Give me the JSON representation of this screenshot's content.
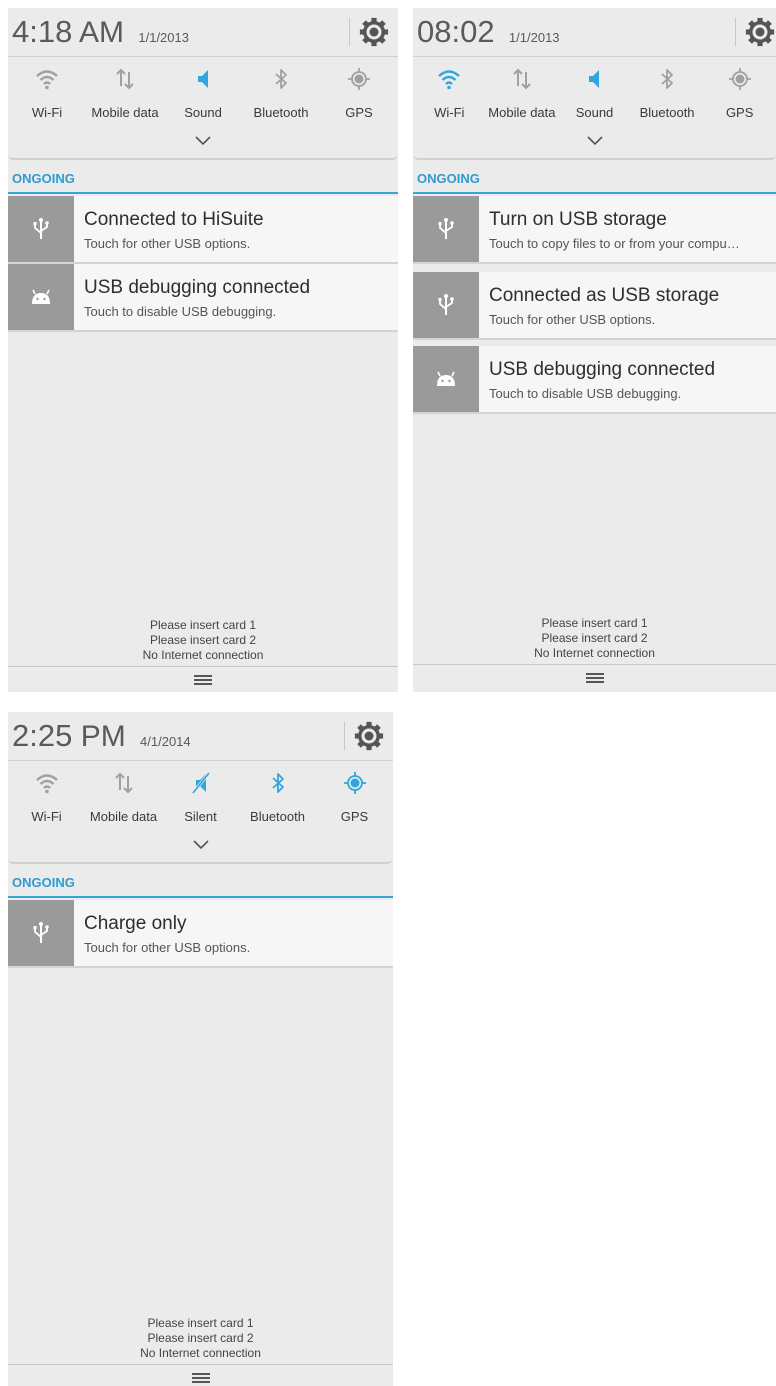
{
  "panels": [
    {
      "time": "4:18",
      "ampm": "AM",
      "date": "1/1/2013",
      "toggles": [
        {
          "label": "Wi-Fi",
          "icon": "wifi-icon",
          "active": false
        },
        {
          "label": "Mobile data",
          "icon": "mobile-data-icon",
          "active": false
        },
        {
          "label": "Sound",
          "icon": "sound-icon",
          "active": true
        },
        {
          "label": "Bluetooth",
          "icon": "bluetooth-icon",
          "active": false
        },
        {
          "label": "GPS",
          "icon": "gps-icon",
          "active": false
        }
      ],
      "section": "ONGOING",
      "notifications": [
        {
          "title": "Connected to HiSuite",
          "subtitle": "Touch for other USB options.",
          "icon": "usb-icon"
        },
        {
          "title": "USB debugging connected",
          "subtitle": "Touch to disable USB debugging.",
          "icon": "android-icon"
        }
      ],
      "footer": [
        "Please insert card 1",
        "Please insert card 2",
        "No Internet connection"
      ]
    },
    {
      "time": "08:02",
      "ampm": "",
      "date": "1/1/2013",
      "toggles": [
        {
          "label": "Wi-Fi",
          "icon": "wifi-icon",
          "active": true
        },
        {
          "label": "Mobile data",
          "icon": "mobile-data-icon",
          "active": false
        },
        {
          "label": "Sound",
          "icon": "sound-icon",
          "active": true
        },
        {
          "label": "Bluetooth",
          "icon": "bluetooth-icon",
          "active": false
        },
        {
          "label": "GPS",
          "icon": "gps-icon",
          "active": false
        }
      ],
      "section": "ONGOING",
      "notifications": [
        {
          "title": "Turn on USB storage",
          "subtitle": "Touch to copy files to or from your compu…",
          "icon": "usb-icon"
        },
        {
          "title": "Connected as USB storage",
          "subtitle": "Touch for other USB options.",
          "icon": "usb-icon"
        },
        {
          "title": "USB debugging connected",
          "subtitle": "Touch to disable USB debugging.",
          "icon": "android-icon"
        }
      ],
      "footer": [
        "Please insert card 1",
        "Please insert card 2",
        "No Internet connection"
      ]
    },
    {
      "time": "2:25",
      "ampm": "PM",
      "date": "4/1/2014",
      "toggles": [
        {
          "label": "Wi-Fi",
          "icon": "wifi-icon",
          "active": false
        },
        {
          "label": "Mobile data",
          "icon": "mobile-data-icon",
          "active": false
        },
        {
          "label": "Silent",
          "icon": "silent-icon",
          "active": true
        },
        {
          "label": "Bluetooth",
          "icon": "bluetooth-icon",
          "active": true
        },
        {
          "label": "GPS",
          "icon": "gps-icon",
          "active": true
        }
      ],
      "section": "ONGOING",
      "notifications": [
        {
          "title": "Charge only",
          "subtitle": "Touch for other USB options.",
          "icon": "usb-icon"
        }
      ],
      "footer": [
        "Please insert card 1",
        "Please insert card 2",
        "No Internet connection"
      ]
    }
  ],
  "colors": {
    "active": "#2fa6dd",
    "inactive": "#a0a0a0",
    "accent": "#35a6d6"
  }
}
